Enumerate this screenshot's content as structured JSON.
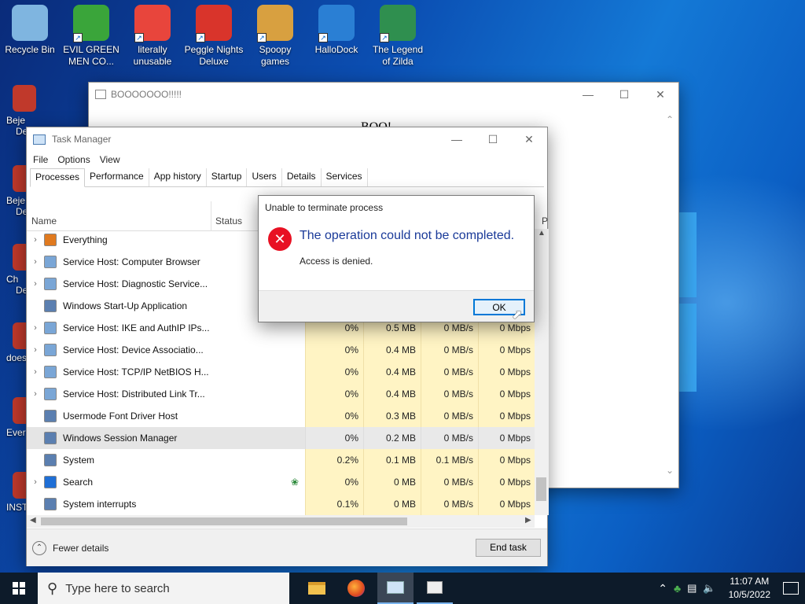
{
  "desktop": {
    "top_icons": [
      {
        "label": "Recycle Bin",
        "icon": "recycle-bin-icon",
        "color": "#7fb5e0"
      },
      {
        "label": "EVIL GREEN MEN CO...",
        "icon": "green-men-icon",
        "color": "#3aa53a"
      },
      {
        "label": "literally unusable",
        "icon": "chrome-icon",
        "color": "#e8453c"
      },
      {
        "label": "Peggle Nights Deluxe",
        "icon": "peggle-icon",
        "color": "#d9342b"
      },
      {
        "label": "Spoopy games",
        "icon": "folder-icon",
        "color": "#d8a040"
      },
      {
        "label": "HalloDock",
        "icon": "shield-icon",
        "color": "#2a7fd4"
      },
      {
        "label": "The Legend of Zilda",
        "icon": "zilda-icon",
        "color": "#2f8f4f"
      }
    ],
    "left_icons": [
      {
        "label": "Beje",
        "sub": "De"
      },
      {
        "label": "Beje",
        "sub": "De"
      },
      {
        "label": "Ch",
        "sub": "De"
      },
      {
        "label": "does",
        "sub": ""
      },
      {
        "label": "Ever",
        "sub": ""
      },
      {
        "label": "INSTA",
        "sub": ""
      }
    ]
  },
  "boo_window": {
    "title": "BOOOOOOO!!!!!",
    "content": "BOO!"
  },
  "task_manager": {
    "title": "Task Manager",
    "menu": [
      "File",
      "Options",
      "View"
    ],
    "tabs": [
      "Processes",
      "Performance",
      "App history",
      "Startup",
      "Users",
      "Details",
      "Services"
    ],
    "columns": {
      "name": "Name",
      "status": "Status",
      "extra": "P"
    },
    "processes": [
      {
        "name": "Everything",
        "expand": true,
        "icon": "search-orange-icon",
        "status": "",
        "cpu": "",
        "mem": "",
        "disk": "",
        "net": ""
      },
      {
        "name": "Service Host: Computer Browser",
        "expand": true,
        "icon": "gear-icon",
        "status": "",
        "cpu": "",
        "mem": "",
        "disk": "",
        "net": ""
      },
      {
        "name": "Service Host: Diagnostic Service...",
        "expand": true,
        "icon": "gear-icon",
        "status": "",
        "cpu": "",
        "mem": "",
        "disk": "",
        "net": ""
      },
      {
        "name": "Windows Start-Up Application",
        "expand": false,
        "icon": "window-icon",
        "status": "",
        "cpu": "",
        "mem": "",
        "disk": "",
        "net": ""
      },
      {
        "name": "Service Host: IKE and AuthIP IPs...",
        "expand": true,
        "icon": "gear-icon",
        "status": "",
        "cpu": "0%",
        "mem": "0.5 MB",
        "disk": "0 MB/s",
        "net": "0 Mbps"
      },
      {
        "name": "Service Host: Device Associatio...",
        "expand": true,
        "icon": "gear-icon",
        "status": "",
        "cpu": "0%",
        "mem": "0.4 MB",
        "disk": "0 MB/s",
        "net": "0 Mbps"
      },
      {
        "name": "Service Host: TCP/IP NetBIOS H...",
        "expand": true,
        "icon": "gear-icon",
        "status": "",
        "cpu": "0%",
        "mem": "0.4 MB",
        "disk": "0 MB/s",
        "net": "0 Mbps"
      },
      {
        "name": "Service Host: Distributed Link Tr...",
        "expand": true,
        "icon": "gear-icon",
        "status": "",
        "cpu": "0%",
        "mem": "0.4 MB",
        "disk": "0 MB/s",
        "net": "0 Mbps"
      },
      {
        "name": "Usermode Font Driver Host",
        "expand": false,
        "icon": "window-icon",
        "status": "",
        "cpu": "0%",
        "mem": "0.3 MB",
        "disk": "0 MB/s",
        "net": "0 Mbps"
      },
      {
        "name": "Windows Session Manager",
        "expand": false,
        "icon": "window-icon",
        "status": "",
        "cpu": "0%",
        "mem": "0.2 MB",
        "disk": "0 MB/s",
        "net": "0 Mbps",
        "selected": true
      },
      {
        "name": "System",
        "expand": false,
        "icon": "window-icon",
        "status": "",
        "cpu": "0.2%",
        "mem": "0.1 MB",
        "disk": "0.1 MB/s",
        "net": "0 Mbps"
      },
      {
        "name": "Search",
        "expand": true,
        "icon": "search-blue-icon",
        "status": "leaf",
        "cpu": "0%",
        "mem": "0 MB",
        "disk": "0 MB/s",
        "net": "0 Mbps"
      },
      {
        "name": "System interrupts",
        "expand": false,
        "icon": "window-icon",
        "status": "",
        "cpu": "0.1%",
        "mem": "0 MB",
        "disk": "0 MB/s",
        "net": "0 Mbps"
      }
    ],
    "fewer_details": "Fewer details",
    "end_task": "End task"
  },
  "dialog": {
    "title": "Unable to terminate process",
    "heading": "The operation could not be completed.",
    "message": "Access is denied.",
    "ok": "OK"
  },
  "taskbar": {
    "search_placeholder": "Type here to search",
    "time": "11:07 AM",
    "date": "10/5/2022"
  },
  "colors": {
    "accent": "#0078d7",
    "error": "#e81123",
    "usage_fill": "#fff4c4"
  }
}
